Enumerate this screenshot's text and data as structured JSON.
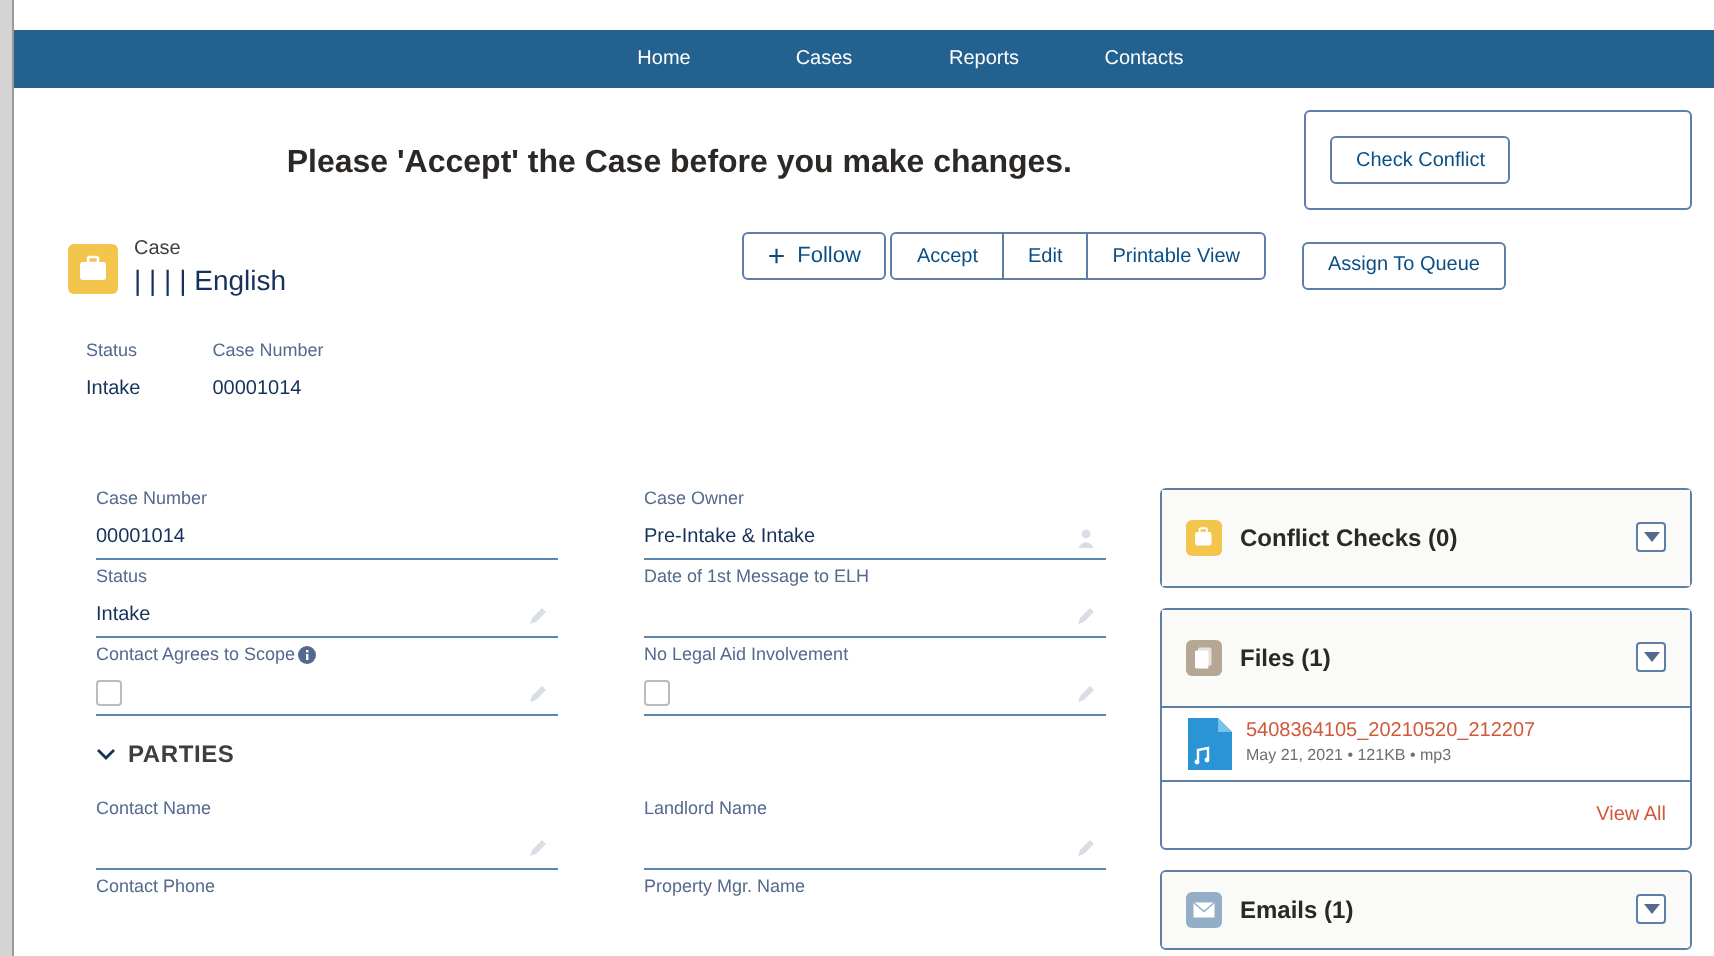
{
  "nav": {
    "items": [
      {
        "label": "Home"
      },
      {
        "label": "Cases"
      },
      {
        "label": "Reports"
      },
      {
        "label": "Contacts"
      }
    ]
  },
  "banner": {
    "message": "Please 'Accept' the Case before you make changes.",
    "check_conflict": "Check Conflict",
    "assign": "Assign To Queue"
  },
  "record": {
    "object": "Case",
    "title": "| | | | English",
    "follow": "+",
    "follow_label": "Follow",
    "actions": [
      "Accept",
      "Edit",
      "Printable View"
    ]
  },
  "highlights": [
    {
      "label": "Status",
      "value": "Intake"
    },
    {
      "label": "Case Number",
      "value": "00001014"
    }
  ],
  "fields": [
    {
      "kind": "text",
      "label": "Case Number",
      "value": "00001014",
      "editable": false,
      "owner_icon": false
    },
    {
      "kind": "text",
      "label": "Case Owner",
      "value": "Pre-Intake & Intake",
      "owner_icon": true
    },
    {
      "kind": "text",
      "label": "Status",
      "value": "Intake",
      "editable": true,
      "owner_icon": false
    },
    {
      "kind": "text",
      "label": "Date of 1st Message to ELH",
      "editable": true,
      "owner_icon": false
    },
    {
      "kind": "checkbox",
      "label": "Contact Agrees to Scope",
      "info": true,
      "checked": false,
      "editable": true
    },
    {
      "kind": "checkbox",
      "label": "No Legal Aid Involvement",
      "info": false,
      "checked": false,
      "editable": true
    }
  ],
  "section": {
    "title": "PARTIES",
    "expanded": true
  },
  "party_fields": [
    {
      "kind": "text",
      "label": "Contact Name",
      "editable": true
    },
    {
      "kind": "text",
      "label": "Landlord Name",
      "editable": true
    },
    {
      "kind": "label",
      "label": "Contact Phone"
    },
    {
      "kind": "label",
      "label": "Property Mgr. Name"
    }
  ],
  "related": [
    {
      "kind": "conflict",
      "title": "Conflict Checks (0)",
      "color": "#f4c54c"
    },
    {
      "kind": "files",
      "title": "Files (1)",
      "color": "#b6a795",
      "file": {
        "name": "5408364105_20210520_212207",
        "meta": "May 21, 2021 • 121KB • mp3"
      },
      "view_all": "View All"
    },
    {
      "kind": "emails",
      "title": "Emails (1)",
      "color": "#95aec8"
    }
  ]
}
